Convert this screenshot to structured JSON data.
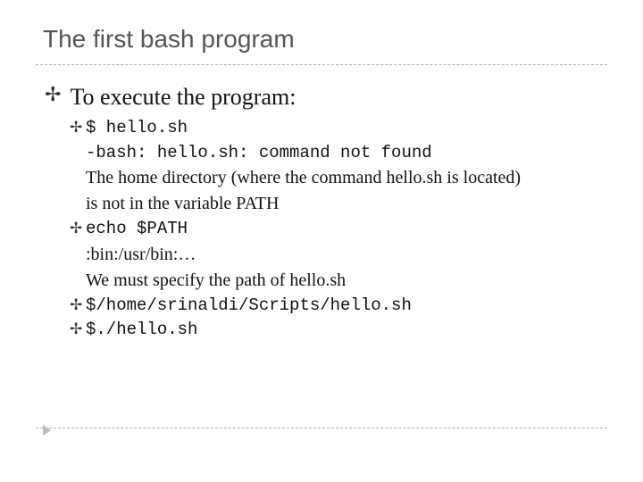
{
  "title": "The first bash program",
  "heading": "To execute the program:",
  "lines": {
    "cmd1": "$ hello.sh",
    "err": "-bash: hello.sh: command not found",
    "note1a": "The home directory (where the command hello.sh is located)",
    "note1b": "is not in the variable PATH",
    "cmd2": "echo $PATH",
    "out2": ":bin:/usr/bin:…",
    "note2": "We must specify the path of hello.sh",
    "cmd3": "$/home/srinaldi/Scripts/hello.sh",
    "cmd4": "$./hello.sh"
  }
}
